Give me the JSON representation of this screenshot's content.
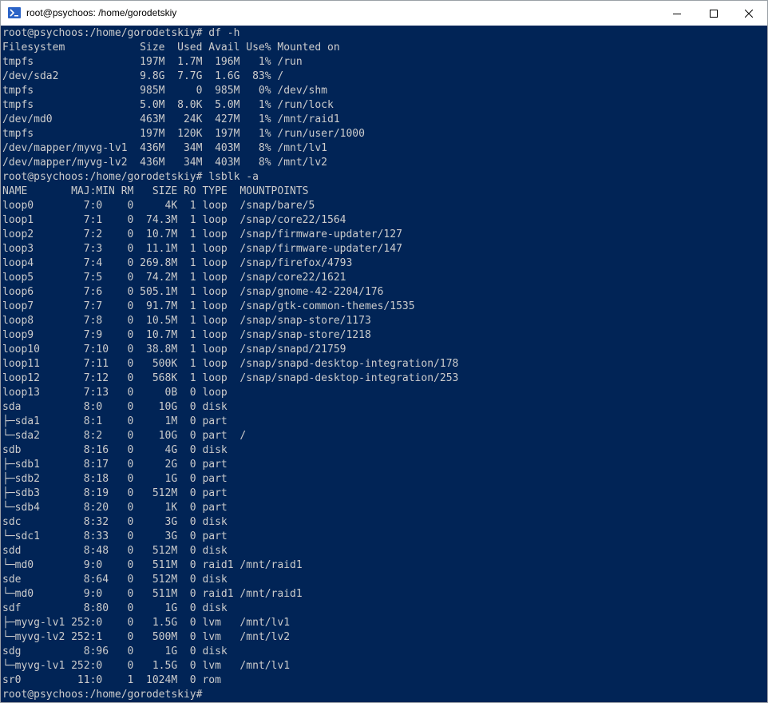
{
  "window": {
    "title": "root@psychoos: /home/gorodetskiy",
    "minimize_icon": "minimize-icon",
    "maximize_icon": "maximize-icon",
    "close_icon": "close-icon"
  },
  "colors": {
    "terminal_background": "#012456",
    "terminal_text": "#cccccc",
    "titlebar_background": "#ffffff"
  },
  "terminal": {
    "lines": [
      "root@psychoos:/home/gorodetskiy# df -h",
      "Filesystem            Size  Used Avail Use% Mounted on",
      "tmpfs                 197M  1.7M  196M   1% /run",
      "/dev/sda2             9.8G  7.7G  1.6G  83% /",
      "tmpfs                 985M     0  985M   0% /dev/shm",
      "tmpfs                 5.0M  8.0K  5.0M   1% /run/lock",
      "/dev/md0              463M   24K  427M   1% /mnt/raid1",
      "tmpfs                 197M  120K  197M   1% /run/user/1000",
      "/dev/mapper/myvg-lv1  436M   34M  403M   8% /mnt/lv1",
      "/dev/mapper/myvg-lv2  436M   34M  403M   8% /mnt/lv2",
      "root@psychoos:/home/gorodetskiy# lsblk -a",
      "NAME       MAJ:MIN RM   SIZE RO TYPE  MOUNTPOINTS",
      "loop0        7:0    0     4K  1 loop  /snap/bare/5",
      "loop1        7:1    0  74.3M  1 loop  /snap/core22/1564",
      "loop2        7:2    0  10.7M  1 loop  /snap/firmware-updater/127",
      "loop3        7:3    0  11.1M  1 loop  /snap/firmware-updater/147",
      "loop4        7:4    0 269.8M  1 loop  /snap/firefox/4793",
      "loop5        7:5    0  74.2M  1 loop  /snap/core22/1621",
      "loop6        7:6    0 505.1M  1 loop  /snap/gnome-42-2204/176",
      "loop7        7:7    0  91.7M  1 loop  /snap/gtk-common-themes/1535",
      "loop8        7:8    0  10.5M  1 loop  /snap/snap-store/1173",
      "loop9        7:9    0  10.7M  1 loop  /snap/snap-store/1218",
      "loop10       7:10   0  38.8M  1 loop  /snap/snapd/21759",
      "loop11       7:11   0   500K  1 loop  /snap/snapd-desktop-integration/178",
      "loop12       7:12   0   568K  1 loop  /snap/snapd-desktop-integration/253",
      "loop13       7:13   0     0B  0 loop",
      "sda          8:0    0    10G  0 disk",
      "├─sda1       8:1    0     1M  0 part",
      "└─sda2       8:2    0    10G  0 part  /",
      "sdb          8:16   0     4G  0 disk",
      "├─sdb1       8:17   0     2G  0 part",
      "├─sdb2       8:18   0     1G  0 part",
      "├─sdb3       8:19   0   512M  0 part",
      "└─sdb4       8:20   0     1K  0 part",
      "sdc          8:32   0     3G  0 disk",
      "└─sdc1       8:33   0     3G  0 part",
      "sdd          8:48   0   512M  0 disk",
      "└─md0        9:0    0   511M  0 raid1 /mnt/raid1",
      "sde          8:64   0   512M  0 disk",
      "└─md0        9:0    0   511M  0 raid1 /mnt/raid1",
      "sdf          8:80   0     1G  0 disk",
      "├─myvg-lv1 252:0    0   1.5G  0 lvm   /mnt/lv1",
      "└─myvg-lv2 252:1    0   500M  0 lvm   /mnt/lv2",
      "sdg          8:96   0     1G  0 disk",
      "└─myvg-lv1 252:0    0   1.5G  0 lvm   /mnt/lv1",
      "sr0         11:0    1  1024M  0 rom",
      "root@psychoos:/home/gorodetskiy#"
    ]
  }
}
